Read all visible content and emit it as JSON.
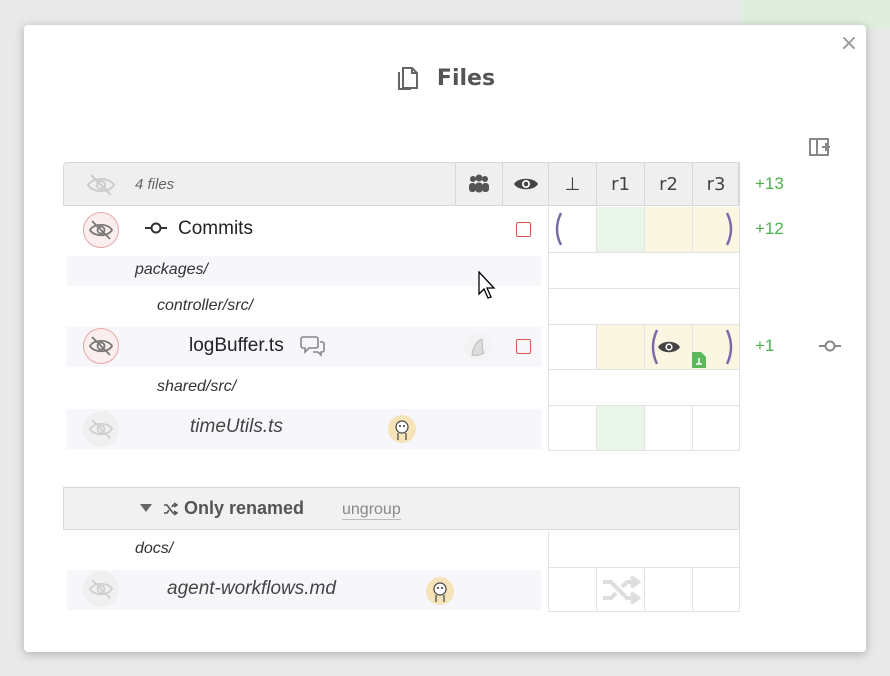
{
  "dialog": {
    "title": "Files",
    "close_label": "×"
  },
  "header": {
    "files_count": "4 files",
    "columns": [
      "⊥",
      "r1",
      "r2",
      "r3"
    ],
    "total_changes": "+13"
  },
  "rows": {
    "commits": {
      "label": "Commits",
      "changes": "+12"
    },
    "dir_packages": "packages/",
    "dir_controller": "controller/src/",
    "logbuffer": {
      "name": "logBuffer.ts",
      "changes": "+1"
    },
    "dir_shared": "shared/src/",
    "timeutils": {
      "name": "timeUtils.ts"
    },
    "group": {
      "label": "Only renamed",
      "ungroup": "ungroup"
    },
    "dir_docs": "docs/",
    "agent": {
      "name": "agent-workflows.md"
    }
  },
  "colors": {
    "accent_green": "#4caf50",
    "unchecked_red": "#d9534f",
    "diff_green_bg": "#eaf5e9",
    "diff_yellow_bg": "#fbf6e2",
    "bracket_purple": "#6a5a9a"
  },
  "icons": [
    "file-copy-icon",
    "close-icon",
    "split-panel-icon",
    "eye-off-icon",
    "users-icon",
    "eye-icon",
    "commit-icon",
    "comments-icon",
    "shuffle-icon",
    "caret-down-icon",
    "cursor-icon"
  ]
}
